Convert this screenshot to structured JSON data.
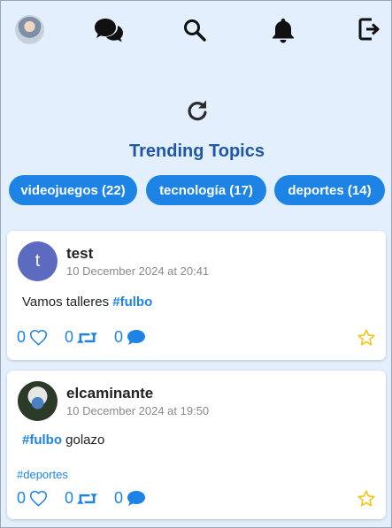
{
  "topbar": {
    "icons": [
      "user-avatar",
      "chat-bubbles-icon",
      "search-icon",
      "bell-icon",
      "logout-icon"
    ]
  },
  "trending": {
    "title": "Trending Topics",
    "chips": [
      {
        "label": "videojuegos (22)"
      },
      {
        "label": "tecnología (17)"
      },
      {
        "label": "deportes (14)"
      }
    ]
  },
  "posts": [
    {
      "avatar_letter": "t",
      "username": "test",
      "timestamp": "10 December 2024 at 20:41",
      "text_before": "Vamos talleres ",
      "hashtag": "#fulbo",
      "text_after": "",
      "tag": "",
      "likes": "0",
      "reposts": "0",
      "comments": "0"
    },
    {
      "avatar_letter": "",
      "username": "elcaminante",
      "timestamp": "10 December 2024 at 19:50",
      "text_before": "",
      "hashtag": "#fulbo",
      "text_after": " golazo",
      "tag": "#deportes",
      "likes": "0",
      "reposts": "0",
      "comments": "0"
    }
  ],
  "colors": {
    "background": "#e3effc",
    "accent": "#1d84e5",
    "title": "#1f56a5",
    "star": "#f5c518"
  }
}
